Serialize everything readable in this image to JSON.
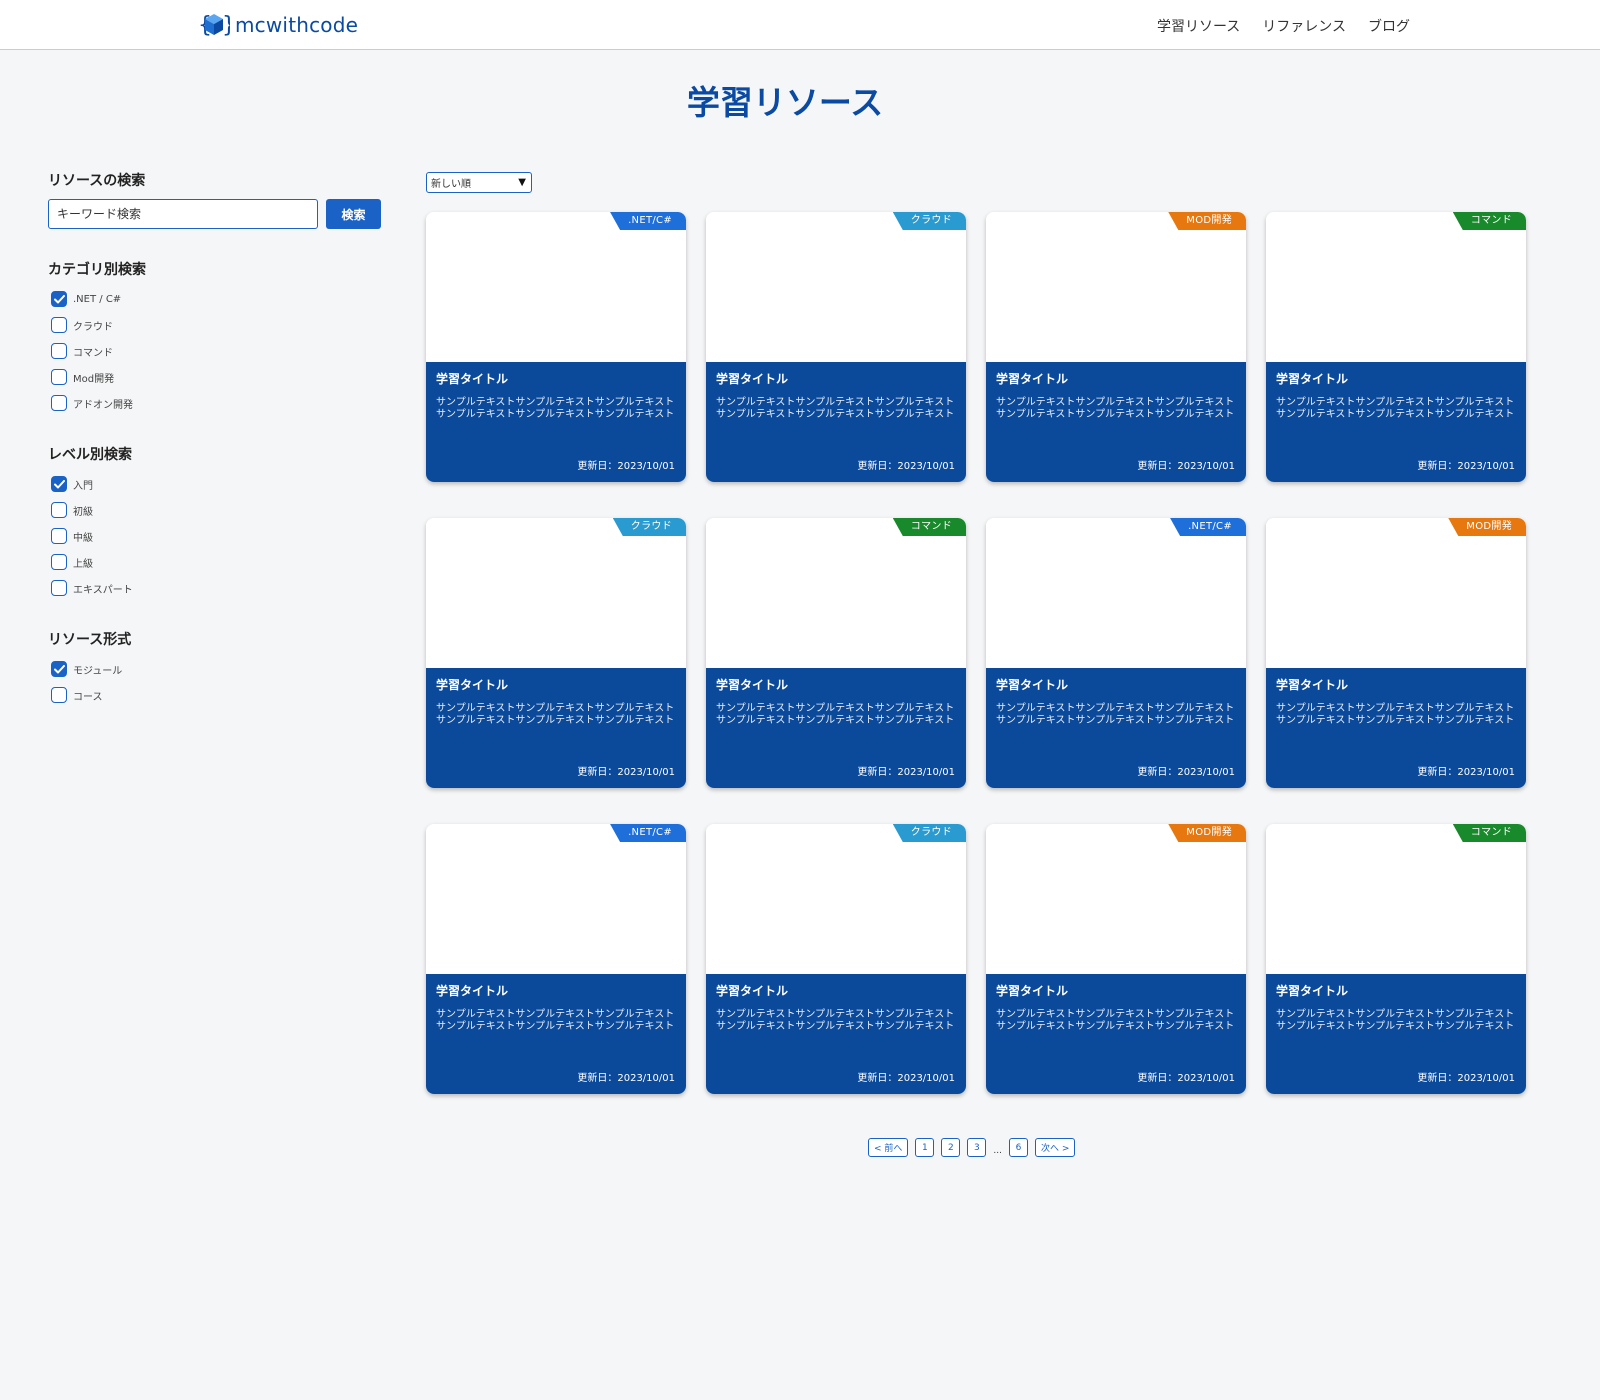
{
  "header": {
    "logo_text": "mcwithcode",
    "nav": [
      "学習リソース",
      "リファレンス",
      "ブログ"
    ]
  },
  "page_title": "学習リソース",
  "sidebar": {
    "search_heading": "リソースの検索",
    "search_placeholder": "キーワード検索",
    "search_button": "検索",
    "groups": [
      {
        "heading": "カテゴリ別検索",
        "items": [
          {
            "label": ".NET / C#",
            "checked": true
          },
          {
            "label": "クラウド",
            "checked": false
          },
          {
            "label": "コマンド",
            "checked": false
          },
          {
            "label": "Mod開発",
            "checked": false
          },
          {
            "label": "アドオン開発",
            "checked": false
          }
        ]
      },
      {
        "heading": "レベル別検索",
        "items": [
          {
            "label": "入門",
            "checked": true
          },
          {
            "label": "初級",
            "checked": false
          },
          {
            "label": "中級",
            "checked": false
          },
          {
            "label": "上級",
            "checked": false
          },
          {
            "label": "エキスパート",
            "checked": false
          }
        ]
      },
      {
        "heading": "リソース形式",
        "items": [
          {
            "label": "モジュール",
            "checked": true
          },
          {
            "label": "コース",
            "checked": false
          }
        ]
      }
    ]
  },
  "sort": {
    "selected": "新しい順"
  },
  "cards": [
    {
      "badge": ".NET/C#",
      "badge_color": "#1e6fd9",
      "title": "学習タイトル",
      "desc": "サンプルテキストサンプルテキストサンプルテキストサンプルテキストサンプルテキストサンプルテキスト",
      "date": "更新日：2023/10/01"
    },
    {
      "badge": "クラウド",
      "badge_color": "#2a9bd1",
      "title": "学習タイトル",
      "desc": "サンプルテキストサンプルテキストサンプルテキストサンプルテキストサンプルテキストサンプルテキスト",
      "date": "更新日：2023/10/01"
    },
    {
      "badge": "MOD開発",
      "badge_color": "#e6780f",
      "title": "学習タイトル",
      "desc": "サンプルテキストサンプルテキストサンプルテキストサンプルテキストサンプルテキストサンプルテキスト",
      "date": "更新日：2023/10/01"
    },
    {
      "badge": "コマンド",
      "badge_color": "#198a2c",
      "title": "学習タイトル",
      "desc": "サンプルテキストサンプルテキストサンプルテキストサンプルテキストサンプルテキストサンプルテキスト",
      "date": "更新日：2023/10/01"
    },
    {
      "badge": "クラウド",
      "badge_color": "#2a9bd1",
      "title": "学習タイトル",
      "desc": "サンプルテキストサンプルテキストサンプルテキストサンプルテキストサンプルテキストサンプルテキスト",
      "date": "更新日：2023/10/01"
    },
    {
      "badge": "コマンド",
      "badge_color": "#198a2c",
      "title": "学習タイトル",
      "desc": "サンプルテキストサンプルテキストサンプルテキストサンプルテキストサンプルテキストサンプルテキスト",
      "date": "更新日：2023/10/01"
    },
    {
      "badge": ".NET/C#",
      "badge_color": "#1e6fd9",
      "title": "学習タイトル",
      "desc": "サンプルテキストサンプルテキストサンプルテキストサンプルテキストサンプルテキストサンプルテキスト",
      "date": "更新日：2023/10/01"
    },
    {
      "badge": "MOD開発",
      "badge_color": "#e6780f",
      "title": "学習タイトル",
      "desc": "サンプルテキストサンプルテキストサンプルテキストサンプルテキストサンプルテキストサンプルテキスト",
      "date": "更新日：2023/10/01"
    },
    {
      "badge": ".NET/C#",
      "badge_color": "#1e6fd9",
      "title": "学習タイトル",
      "desc": "サンプルテキストサンプルテキストサンプルテキストサンプルテキストサンプルテキストサンプルテキスト",
      "date": "更新日：2023/10/01"
    },
    {
      "badge": "クラウド",
      "badge_color": "#2a9bd1",
      "title": "学習タイトル",
      "desc": "サンプルテキストサンプルテキストサンプルテキストサンプルテキストサンプルテキストサンプルテキスト",
      "date": "更新日：2023/10/01"
    },
    {
      "badge": "MOD開発",
      "badge_color": "#e6780f",
      "title": "学習タイトル",
      "desc": "サンプルテキストサンプルテキストサンプルテキストサンプルテキストサンプルテキストサンプルテキスト",
      "date": "更新日：2023/10/01"
    },
    {
      "badge": "コマンド",
      "badge_color": "#198a2c",
      "title": "学習タイトル",
      "desc": "サンプルテキストサンプルテキストサンプルテキストサンプルテキストサンプルテキストサンプルテキスト",
      "date": "更新日：2023/10/01"
    }
  ],
  "pagination": {
    "prev": "< 前へ",
    "pages": [
      "1",
      "2",
      "3"
    ],
    "ellipsis": "...",
    "last": "6",
    "next": "次へ >"
  },
  "colors": {
    "brand": "#0b4aa2",
    "card_body": "#0b4a9b",
    "accent": "#1a62c6"
  },
  "icons": {
    "logo": "cube-logo-icon",
    "checkbox": "checkmark-icon",
    "sort": "triangle-down-icon"
  }
}
